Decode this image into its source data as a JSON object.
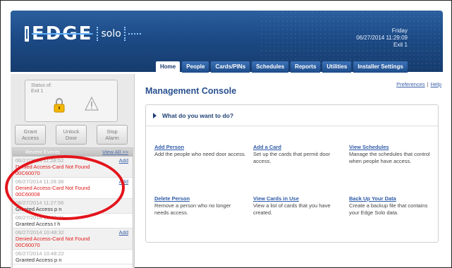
{
  "header": {
    "logo_brand": "EDGE",
    "logo_sub": "solo",
    "day": "Friday",
    "datetime": "06/27/2014 11:29:09",
    "exit": "Exit 1"
  },
  "tabs": [
    {
      "label": "Home",
      "active": true
    },
    {
      "label": "People"
    },
    {
      "label": "Cards/PINs"
    },
    {
      "label": "Schedules"
    },
    {
      "label": "Reports"
    },
    {
      "label": "Utilities"
    },
    {
      "label": "Installer Settings"
    }
  ],
  "status": {
    "label_line1": "Status of:",
    "label_line2": "Exit 1",
    "icons": [
      "lock-icon",
      "alert-icon"
    ]
  },
  "actions": {
    "grant": {
      "l1": "Grant",
      "l2": "Access"
    },
    "unlock": {
      "l1": "Unlock",
      "l2": "Door"
    },
    "stop": {
      "l1": "Stop",
      "l2": "Alarm"
    }
  },
  "events": {
    "title": "Recent Events",
    "view_all": "View All >>",
    "add_label": "Add",
    "items": [
      {
        "ts": "06/27/2014 11:28:52",
        "msg": "Denied Access-Card Not Found",
        "sub": "00C60070",
        "color": "red",
        "add": true
      },
      {
        "ts": "06/27/2014 11:28:38",
        "msg": "Denied Access-Card Not Found",
        "sub": "00C60008",
        "color": "red",
        "add": true
      },
      {
        "ts": "06/27/2014 11:27:56",
        "msg": "Granted Access p n",
        "sub": "",
        "color": "dark",
        "add": false
      },
      {
        "ts": "06/27/2014 10:49:31",
        "msg": "Granted Access t h",
        "sub": "",
        "color": "dark",
        "add": false
      },
      {
        "ts": "06/27/2014 10:48:32",
        "msg": "Denied Access-Card Not Found",
        "sub": "00C60070",
        "color": "red",
        "add": true
      },
      {
        "ts": "06/27/2014 10:48:22",
        "msg": "Granted Access p n",
        "sub": "",
        "color": "dark",
        "add": false
      }
    ]
  },
  "main": {
    "title": "Management Console",
    "preferences": "Preferences",
    "help": "Help",
    "question": "What do you want to do?",
    "tasks": [
      {
        "title": "Add Person",
        "desc": "Add the people who need door access."
      },
      {
        "title": "Add a Card",
        "desc": "Set up the cards that permit door access."
      },
      {
        "title": "View Schedules",
        "desc": "Manage the schedules that control when people have access."
      },
      {
        "title": "Delete Person",
        "desc": "Remove a person who no longer needs access."
      },
      {
        "title": "View Cards in Use",
        "desc": "View a list of cards that you have created."
      },
      {
        "title": "Back Up Your Data",
        "desc": "Create a backup file that contains your Edge Solo data."
      }
    ]
  },
  "colors": {
    "header_blue": "#1c4a85",
    "title_blue": "#28508e",
    "link_blue": "#2e5aa8",
    "alert_red": "#e21b1b",
    "annotation_red": "#e3141b"
  }
}
